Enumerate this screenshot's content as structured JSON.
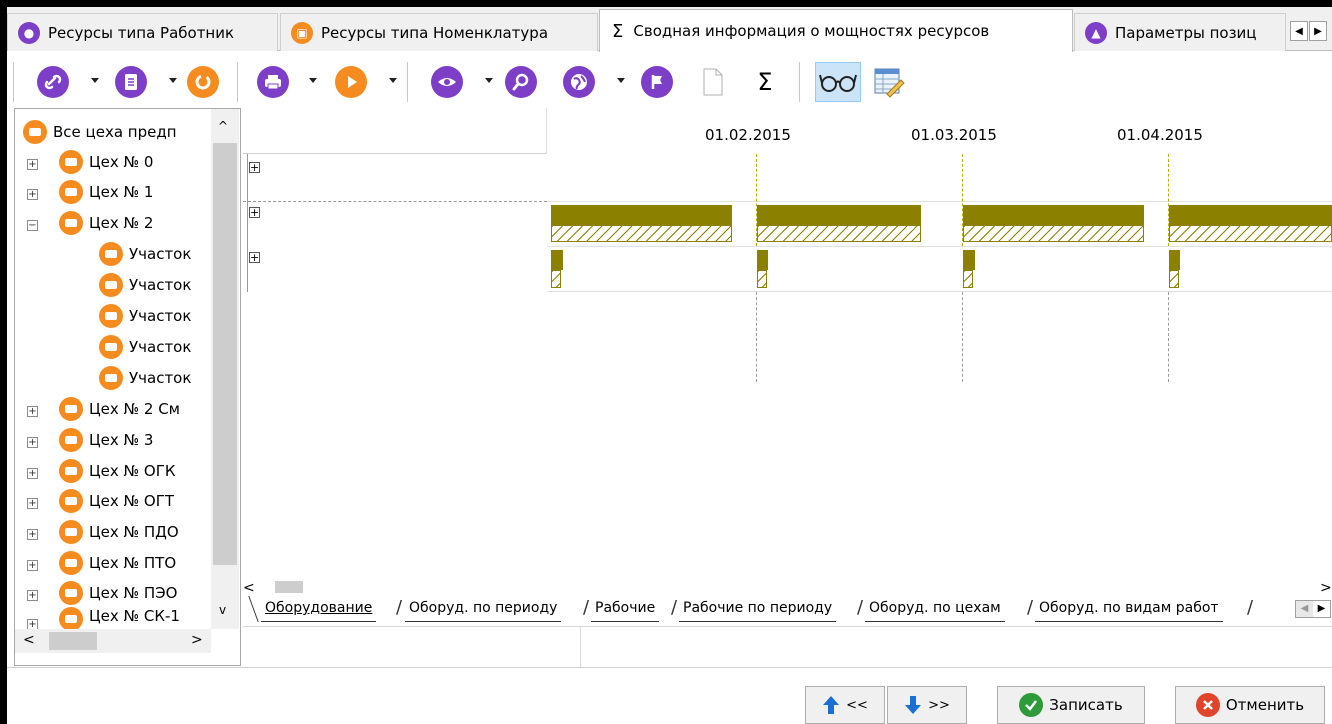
{
  "tabs": [
    {
      "label": "Ресурсы типа Работник",
      "icon": "worker-icon"
    },
    {
      "label": "Ресурсы типа Номенклатура",
      "icon": "nomenclature-icon"
    },
    {
      "label": "Сводная информация о мощностях ресурсов",
      "icon": "sigma-icon"
    },
    {
      "label": "Параметры позиц",
      "icon": "parameters-icon"
    }
  ],
  "toolbar": {
    "sigma_label": "Σ"
  },
  "tree": {
    "root": "Все цеха предп",
    "items": [
      {
        "label": "Цех № 0",
        "level": 1
      },
      {
        "label": "Цех № 1",
        "level": 1
      },
      {
        "label": "Цех № 2",
        "level": 1
      },
      {
        "label": "Участок",
        "level": 2
      },
      {
        "label": "Участок",
        "level": 2
      },
      {
        "label": "Участок",
        "level": 2
      },
      {
        "label": "Участок",
        "level": 2
      },
      {
        "label": "Участок",
        "level": 2
      },
      {
        "label": "Цех № 2 См",
        "level": 1
      },
      {
        "label": "Цех № 3",
        "level": 1
      },
      {
        "label": "Цех № ОГК",
        "level": 1
      },
      {
        "label": "Цех № ОГТ",
        "level": 1
      },
      {
        "label": "Цех № ПДО",
        "level": 1
      },
      {
        "label": "Цех № ПТО",
        "level": 1
      },
      {
        "label": "Цех № ПЭО",
        "level": 1
      },
      {
        "label": "Цех № СК-1",
        "level": 1
      }
    ]
  },
  "gantt": {
    "dates": [
      "01.02.2015",
      "01.03.2015",
      "01.04.2015"
    ]
  },
  "bottom_tabs": [
    "Оборудование",
    "Оборуд. по периоду",
    "Рабочие",
    "Рабочие по периоду",
    "Оборуд. по цехам",
    "Оборуд. по видам работ"
  ],
  "buttons": {
    "prev": "<<",
    "next": ">>",
    "save": "Записать",
    "cancel": "Отменить"
  },
  "colors": {
    "accent_purple": "#7d3fc8",
    "accent_orange": "#f68b1f",
    "bar_olive": "#8c8000",
    "save_green": "#2e9b3a",
    "cancel_red": "#e0442a"
  }
}
